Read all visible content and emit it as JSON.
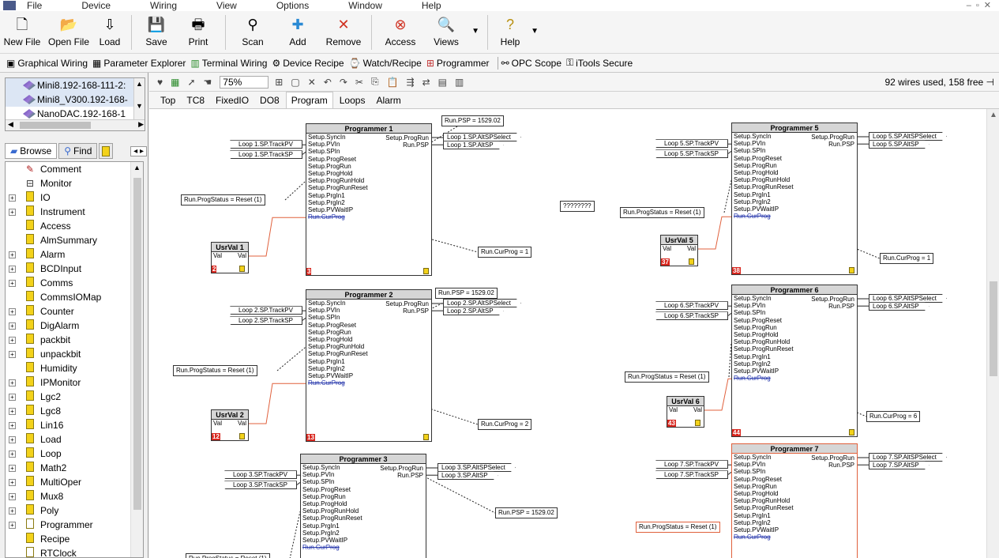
{
  "menu": [
    "File",
    "Device",
    "Wiring",
    "View",
    "Options",
    "Window",
    "Help"
  ],
  "toolbar": [
    {
      "label": "New File",
      "icon": "new-file-icon",
      "glyph": "🗋"
    },
    {
      "label": "Open File",
      "icon": "open-file-icon",
      "glyph": "📂"
    },
    {
      "label": "Load",
      "icon": "load-icon",
      "glyph": "⇩"
    },
    {
      "label": "Save",
      "icon": "save-icon",
      "glyph": "💾"
    },
    {
      "label": "Print",
      "icon": "print-icon",
      "glyph": "🖶"
    },
    {
      "label": "Scan",
      "icon": "scan-icon",
      "glyph": "⚲"
    },
    {
      "label": "Add",
      "icon": "add-icon",
      "glyph": "✚"
    },
    {
      "label": "Remove",
      "icon": "remove-icon",
      "glyph": "✕"
    },
    {
      "label": "Access",
      "icon": "access-icon",
      "glyph": "⊗"
    },
    {
      "label": "Views",
      "icon": "views-icon",
      "glyph": "🔍"
    },
    {
      "label": "Help",
      "icon": "help-icon",
      "glyph": "?"
    }
  ],
  "nav": [
    "Graphical Wiring",
    "Parameter Explorer",
    "Terminal Wiring",
    "Device Recipe",
    "Watch/Recipe",
    "Programmer",
    "OPC Scope",
    "iTools Secure"
  ],
  "devices": [
    "Mini8.192-168-111-2:",
    "Mini8_V300.192-168-",
    "NanoDAC.192-168-1"
  ],
  "browse": {
    "browse": "Browse",
    "find": "Find"
  },
  "tree": [
    {
      "label": "Comment",
      "expand": false,
      "icon": "pencil"
    },
    {
      "label": "Monitor",
      "expand": false,
      "icon": "monitor"
    },
    {
      "label": "IO",
      "expand": true,
      "icon": "block"
    },
    {
      "label": "Instrument",
      "expand": true,
      "icon": "block"
    },
    {
      "label": "Access",
      "expand": false,
      "icon": "block"
    },
    {
      "label": "AlmSummary",
      "expand": false,
      "icon": "block"
    },
    {
      "label": "Alarm",
      "expand": true,
      "icon": "block"
    },
    {
      "label": "BCDInput",
      "expand": true,
      "icon": "block"
    },
    {
      "label": "Comms",
      "expand": true,
      "icon": "block"
    },
    {
      "label": "CommsIOMap",
      "expand": false,
      "icon": "block"
    },
    {
      "label": "Counter",
      "expand": true,
      "icon": "block"
    },
    {
      "label": "DigAlarm",
      "expand": true,
      "icon": "block"
    },
    {
      "label": "packbit",
      "expand": true,
      "icon": "block"
    },
    {
      "label": "unpackbit",
      "expand": true,
      "icon": "block"
    },
    {
      "label": "Humidity",
      "expand": false,
      "icon": "block"
    },
    {
      "label": "IPMonitor",
      "expand": true,
      "icon": "block"
    },
    {
      "label": "Lgc2",
      "expand": true,
      "icon": "block"
    },
    {
      "label": "Lgc8",
      "expand": true,
      "icon": "block"
    },
    {
      "label": "Lin16",
      "expand": true,
      "icon": "block"
    },
    {
      "label": "Load",
      "expand": true,
      "icon": "block"
    },
    {
      "label": "Loop",
      "expand": true,
      "icon": "block"
    },
    {
      "label": "Math2",
      "expand": true,
      "icon": "block"
    },
    {
      "label": "MultiOper",
      "expand": true,
      "icon": "block"
    },
    {
      "label": "Mux8",
      "expand": true,
      "icon": "block"
    },
    {
      "label": "Poly",
      "expand": true,
      "icon": "block"
    },
    {
      "label": "Programmer",
      "expand": true,
      "icon": "blank"
    },
    {
      "label": "Recipe",
      "expand": false,
      "icon": "block"
    },
    {
      "label": "RTClock",
      "expand": false,
      "icon": "blank"
    }
  ],
  "diagram_toolbar": {
    "zoom": "75%",
    "wires_status": "92 wires used, 158 free"
  },
  "tabs": [
    "Top",
    "TC8",
    "FixedIO",
    "DO8",
    "Program",
    "Loops",
    "Alarm"
  ],
  "active_tab": "Program",
  "prog_inputs": [
    "Setup.SyncIn",
    "Setup.PVIn",
    "Setup.SPIn",
    "Setup.ProgReset",
    "Setup.ProgRun",
    "Setup.ProgHold",
    "Setup.ProgRunHold",
    "Setup.ProgRunReset",
    "Setup.PrgIn1",
    "Setup.PrgIn2",
    "Setup.PVWaitIP",
    "Run.CurProg"
  ],
  "prog_outputs": [
    "Setup.ProgRun",
    "Run.PSP"
  ],
  "programmers": [
    {
      "title": "Programmer 1",
      "num": "3",
      "psp": "Run.PSP = 1529.02",
      "status": "Run.ProgStatus = Reset (1)",
      "curprog": "Run.CurProg = 1",
      "trackpv": "Loop 1.SP.TrackPV",
      "tracksp": "Loop 1.SP.TrackSP",
      "altsel": "Loop 1.SP.AltSPSelect",
      "altsp": "Loop 1.SP.AltSP"
    },
    {
      "title": "Programmer 2",
      "num": "13",
      "psp": "Run.PSP = 1529.02",
      "status": "Run.ProgStatus = Reset (1)",
      "curprog": "Run.CurProg = 2",
      "trackpv": "Loop 2.SP.TrackPV",
      "tracksp": "Loop 2.SP.TrackSP",
      "altsel": "Loop 2.SP.AltSPSelect",
      "altsp": "Loop 2.SP.AltSP"
    },
    {
      "title": "Programmer 3",
      "num": "",
      "psp": "Run.PSP = 1529.02",
      "status": "Run.ProgStatus = Reset (1)",
      "curprog": "",
      "trackpv": "Loop 3.SP.TrackPV",
      "tracksp": "Loop 3.SP.TrackSP",
      "altsel": "Loop 3.SP.AltSPSelect",
      "altsp": "Loop 3.SP.AltSP"
    },
    {
      "title": "Programmer 5",
      "num": "38",
      "psp": "",
      "status": "Run.ProgStatus = Reset (1)",
      "curprog": "Run.CurProg = 1",
      "trackpv": "Loop 5.SP.TrackPV",
      "tracksp": "Loop 5.SP.TrackSP",
      "altsel": "Loop 5.SP.AltSPSelect",
      "altsp": "Loop 5.SP.AltSP"
    },
    {
      "title": "Programmer 6",
      "num": "44",
      "psp": "",
      "status": "Run.ProgStatus = Reset (1)",
      "curprog": "Run.CurProg = 6",
      "trackpv": "Loop 6.SP.TrackPV",
      "tracksp": "Loop 6.SP.TrackSP",
      "altsel": "Loop 6.SP.AltSPSelect",
      "altsp": "Loop 6.SP.AltSP"
    },
    {
      "title": "Programmer 7",
      "num": "",
      "psp": "",
      "status": "Run.ProgStatus = Reset (1)",
      "curprog": "",
      "trackpv": "Loop 7.SP.TrackPV",
      "tracksp": "Loop 7.SP.TrackSP",
      "altsel": "Loop 7.SP.AltSPSelect",
      "altsp": "Loop 7.SP.AltSP"
    }
  ],
  "usrvals": [
    {
      "title": "UsrVal 1",
      "num": "2",
      "in": "Val",
      "out": "Val"
    },
    {
      "title": "UsrVal 2",
      "num": "12",
      "in": "Val",
      "out": "Val"
    },
    {
      "title": "UsrVal 5",
      "num": "37",
      "in": "Val",
      "out": "Val"
    },
    {
      "title": "UsrVal 6",
      "num": "43",
      "in": "Val",
      "out": "Val"
    }
  ],
  "unknown_comment": "????????",
  "colors": {
    "selection": "#e0603c",
    "block_number": "#d8261e",
    "curprog_link": "#2233aa"
  }
}
